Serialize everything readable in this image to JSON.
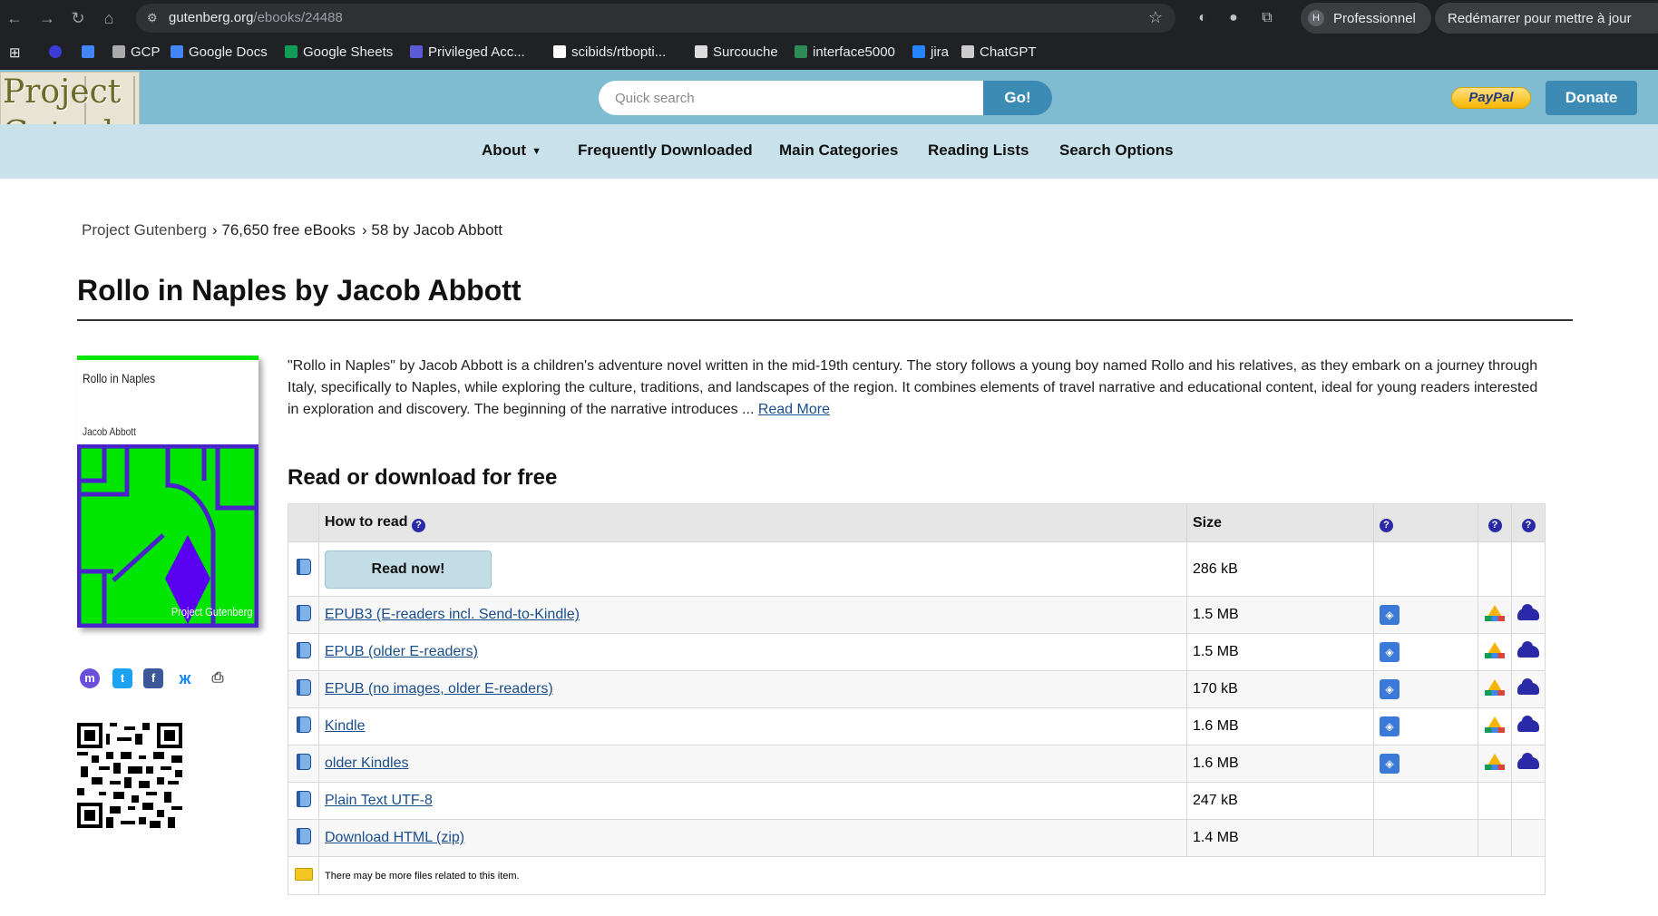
{
  "browser": {
    "url_host": "gutenberg.org",
    "url_path": "/ebooks/24488",
    "profile_initial": "H",
    "profile_label": "Professionnel",
    "restart_label": "Redémarrer pour mettre à jour"
  },
  "bookmarks": [
    {
      "label": "GCP",
      "icon": "gcp-icon",
      "color": "#aaaaaa"
    },
    {
      "label": "Google Docs",
      "icon": "google-docs-icon",
      "color": "#4285f4"
    },
    {
      "label": "Google Sheets",
      "icon": "google-sheets-icon",
      "color": "#0f9d58"
    },
    {
      "label": "Privileged Acc...",
      "icon": "privileged-access-icon",
      "color": "#5b5bd6"
    },
    {
      "label": "scibids/rtbopti...",
      "icon": "github-icon",
      "color": "#ffffff"
    },
    {
      "label": "Surcouche",
      "icon": "surcouche-icon",
      "color": "#dddddd"
    },
    {
      "label": "interface5000",
      "icon": "interface5000-icon",
      "color": "#2e8b57"
    },
    {
      "label": "jira",
      "icon": "jira-icon",
      "color": "#2684ff"
    },
    {
      "label": "ChatGPT",
      "icon": "chatgpt-icon",
      "color": "#cccccc"
    }
  ],
  "site": {
    "logo_line1": "Project",
    "logo_line2": "Gutenberg",
    "search_placeholder": "Quick search",
    "go_label": "Go!",
    "paypal_label": "PayPal",
    "donate_label": "Donate",
    "nav": [
      {
        "label": "About",
        "has_caret": true
      },
      {
        "label": "Frequently Downloaded"
      },
      {
        "label": "Main Categories"
      },
      {
        "label": "Reading Lists"
      },
      {
        "label": "Search Options"
      }
    ],
    "caret": "▼"
  },
  "breadcrumb": [
    "Project Gutenberg",
    "› 76,650 free eBooks",
    "› 58 by Jacob Abbott"
  ],
  "page_title": "Rollo in Naples by Jacob Abbott",
  "cover": {
    "title": "Rollo in Naples",
    "author": "Jacob Abbott",
    "publisher": "Project Gutenberg"
  },
  "share_icons": [
    "mastodon-icon",
    "twitter-icon",
    "facebook-icon",
    "bluesky-icon",
    "print-icon"
  ],
  "description": {
    "text": "\"Rollo in Naples\" by Jacob Abbott is a children's adventure novel written in the mid-19th century. The story follows a young boy named Rollo and his relatives, as they embark on a journey through Italy, specifically to Naples, while exploring the culture, traditions, and landscapes of the region. It combines elements of travel narrative and educational content, ideal for young readers interested in exploration and discovery. The beginning of the narrative introduces ... ",
    "read_more": "Read More"
  },
  "download": {
    "section_title": "Read or download for free",
    "header_how": "How to read",
    "header_size": "Size",
    "read_now_label": "Read now!",
    "read_now_size": "286 kB",
    "formats": [
      {
        "label": "EPUB3 (E-readers incl. Send-to-Kindle)",
        "size": "1.5 MB",
        "cloud": true
      },
      {
        "label": "EPUB (older E-readers)",
        "size": "1.5 MB",
        "cloud": true
      },
      {
        "label": "EPUB (no images, older E-readers)",
        "size": "170 kB",
        "cloud": true
      },
      {
        "label": "Kindle",
        "size": "1.6 MB",
        "cloud": true
      },
      {
        "label": "older Kindles",
        "size": "1.6 MB",
        "cloud": true
      },
      {
        "label": "Plain Text UTF-8",
        "size": "247 kB",
        "cloud": false
      },
      {
        "label": "Download HTML (zip)",
        "size": "1.4 MB",
        "cloud": false
      }
    ],
    "note": "There may be more files related to this item."
  }
}
